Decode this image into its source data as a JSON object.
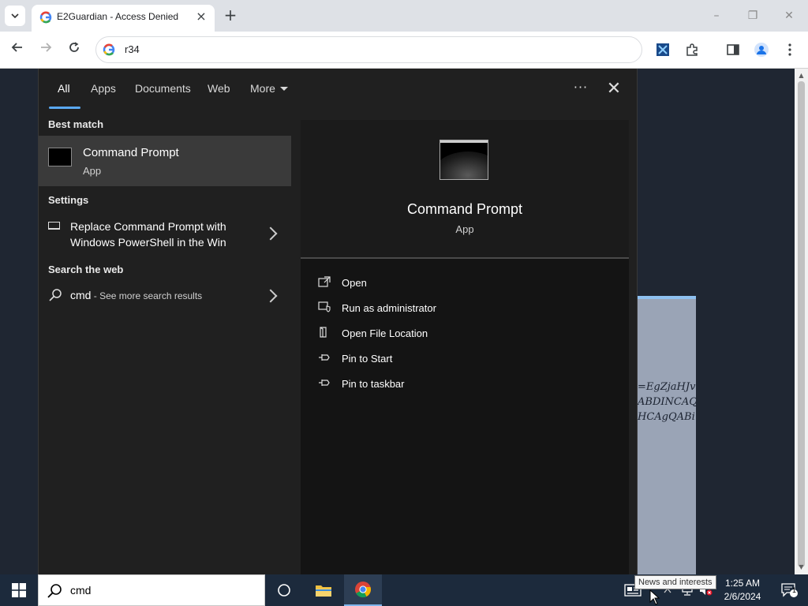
{
  "browser": {
    "tab_title": "E2Guardian - Access Denied",
    "tab_close": "×",
    "new_tab": "+",
    "address": "r34",
    "window_controls": {
      "minimize": "–",
      "restore": "❐",
      "close": "✕"
    }
  },
  "page": {
    "code_lines": [
      "=EgZjaHJv",
      "ABDINCAQ",
      "HCAgQABi"
    ]
  },
  "search_panel": {
    "tabs": [
      {
        "label": "All",
        "active": true
      },
      {
        "label": "Apps",
        "active": false
      },
      {
        "label": "Documents",
        "active": false
      },
      {
        "label": "Web",
        "active": false
      },
      {
        "label": "More",
        "active": false
      }
    ],
    "ellipsis": "···",
    "close": "✕",
    "best_match_heading": "Best match",
    "best_match": {
      "title": "Command Prompt",
      "subtitle": "App"
    },
    "settings_heading": "Settings",
    "settings_item": "Replace Command Prompt with Windows PowerShell in the Win",
    "web_heading": "Search the web",
    "web_item": {
      "query": "cmd",
      "suffix": " - See more search results"
    },
    "detail": {
      "title": "Command Prompt",
      "subtitle": "App",
      "actions": [
        {
          "label": "Open",
          "icon": "open-icon"
        },
        {
          "label": "Run as administrator",
          "icon": "shield-icon"
        },
        {
          "label": "Open File Location",
          "icon": "file-location-icon"
        },
        {
          "label": "Pin to Start",
          "icon": "pin-icon"
        },
        {
          "label": "Pin to taskbar",
          "icon": "pin-icon"
        }
      ]
    }
  },
  "taskbar": {
    "search_text": "cmd",
    "tooltip": "News and interests",
    "time": "1:25 AM",
    "date": "2/6/2024",
    "notification_count": "1"
  },
  "colors": {
    "accent": "#5aa8f0",
    "panel_bg": "#202020",
    "taskbar_bg": "#1c2a3c"
  }
}
